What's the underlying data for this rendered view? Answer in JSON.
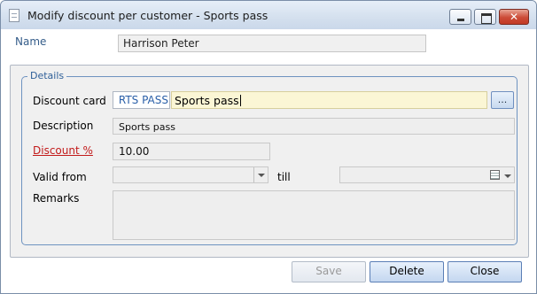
{
  "window": {
    "title": "Modify discount per customer - Sports pass"
  },
  "name": {
    "label": "Name",
    "value": "Harrison Peter"
  },
  "details": {
    "legend": "Details",
    "discount_card": {
      "label": "Discount card",
      "code": "RTS PASS",
      "value": "Sports pass",
      "lookup_label": "..."
    },
    "description": {
      "label": "Description",
      "value": "Sports pass"
    },
    "discount_percent": {
      "label": "Discount %",
      "value": "10.00"
    },
    "valid_from": {
      "label": "Valid from",
      "value": ""
    },
    "till": {
      "label": "till",
      "value": ""
    },
    "remarks": {
      "label": "Remarks",
      "value": ""
    }
  },
  "buttons": {
    "save": "Save",
    "delete": "Delete",
    "close": "Close"
  },
  "colors": {
    "accent_border": "#6e93c0",
    "required_label": "#c21a1a",
    "active_field": "#fbf6d5"
  }
}
